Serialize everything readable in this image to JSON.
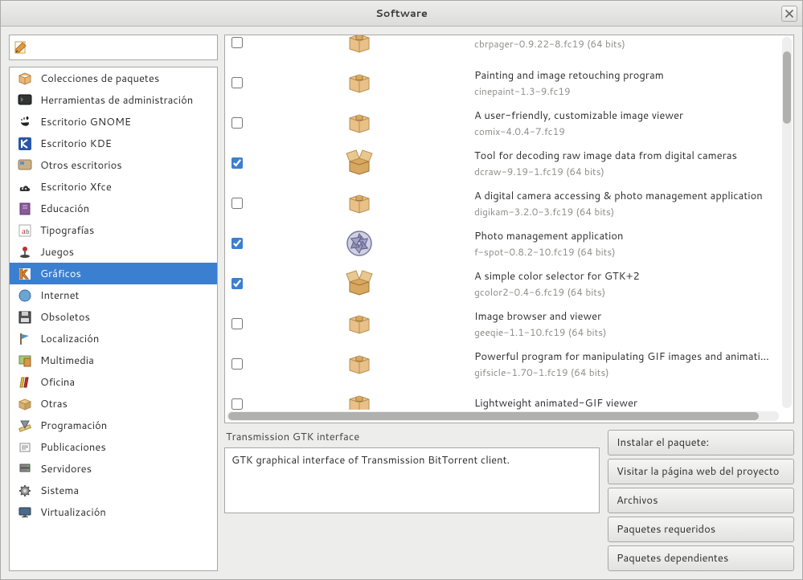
{
  "window": {
    "title": "Software"
  },
  "search": {
    "placeholder": ""
  },
  "sidebar": {
    "items": [
      {
        "label": "Colecciones de paquetes",
        "icon": "package"
      },
      {
        "label": "Herramientas de administración",
        "icon": "terminal"
      },
      {
        "label": "Escritorio GNOME",
        "icon": "gnome"
      },
      {
        "label": "Escritorio KDE",
        "icon": "kde"
      },
      {
        "label": "Otros escritorios",
        "icon": "desktop"
      },
      {
        "label": "Escritorio Xfce",
        "icon": "xfce"
      },
      {
        "label": "Educación",
        "icon": "book"
      },
      {
        "label": "Tipografías",
        "icon": "font"
      },
      {
        "label": "Juegos",
        "icon": "joystick"
      },
      {
        "label": "Gráficos",
        "icon": "graphics",
        "selected": true
      },
      {
        "label": "Internet",
        "icon": "globe"
      },
      {
        "label": "Obsoletos",
        "icon": "floppy"
      },
      {
        "label": "Localización",
        "icon": "flag"
      },
      {
        "label": "Multimedia",
        "icon": "media"
      },
      {
        "label": "Oficina",
        "icon": "office"
      },
      {
        "label": "Otras",
        "icon": "box"
      },
      {
        "label": "Programación",
        "icon": "ruler"
      },
      {
        "label": "Publicaciones",
        "icon": "publish"
      },
      {
        "label": "Servidores",
        "icon": "server"
      },
      {
        "label": "Sistema",
        "icon": "gear"
      },
      {
        "label": "Virtualización",
        "icon": "monitor"
      }
    ]
  },
  "packages": [
    {
      "title": "",
      "sub": "cbrpager-0.9.22-8.fc19 (64 bits)",
      "checked": false,
      "icon": "closed"
    },
    {
      "title": "Painting and image retouching program",
      "sub": "cinepaint-1.3-9.fc19",
      "checked": false,
      "icon": "closed"
    },
    {
      "title": "A user-friendly, customizable image viewer",
      "sub": "comix-4.0.4-7.fc19",
      "checked": false,
      "icon": "closed"
    },
    {
      "title": "Tool for decoding raw image data from digital cameras",
      "sub": "dcraw-9.19-1.fc19 (64 bits)",
      "checked": true,
      "icon": "open"
    },
    {
      "title": "A digital camera accessing & photo management application",
      "sub": "digikam-3.2.0-3.fc19 (64 bits)",
      "checked": false,
      "icon": "closed"
    },
    {
      "title": "Photo management application",
      "sub": "f-spot-0.8.2-10.fc19 (64 bits)",
      "checked": true,
      "icon": "aperture"
    },
    {
      "title": "A simple color selector for GTK+2",
      "sub": "gcolor2-0.4-6.fc19 (64 bits)",
      "checked": true,
      "icon": "open"
    },
    {
      "title": "Image browser and viewer",
      "sub": "geeqie-1.1-10.fc19 (64 bits)",
      "checked": false,
      "icon": "closed"
    },
    {
      "title": "Powerful program for manipulating GIF images and animations",
      "sub": "gifsicle-1.70-1.fc19 (64 bits)",
      "checked": false,
      "icon": "closed"
    },
    {
      "title": "Lightweight animated-GIF viewer",
      "sub": "",
      "checked": false,
      "icon": "closed"
    }
  ],
  "detail": {
    "label": "Transmission GTK interface",
    "description": "GTK graphical interface of Transmission BitTorrent client."
  },
  "actions": {
    "install": "Instalar el paquete:",
    "homepage": "Visitar la página web del proyecto",
    "files": "Archivos",
    "required": "Paquetes requeridos",
    "dependent": "Paquetes dependientes"
  }
}
